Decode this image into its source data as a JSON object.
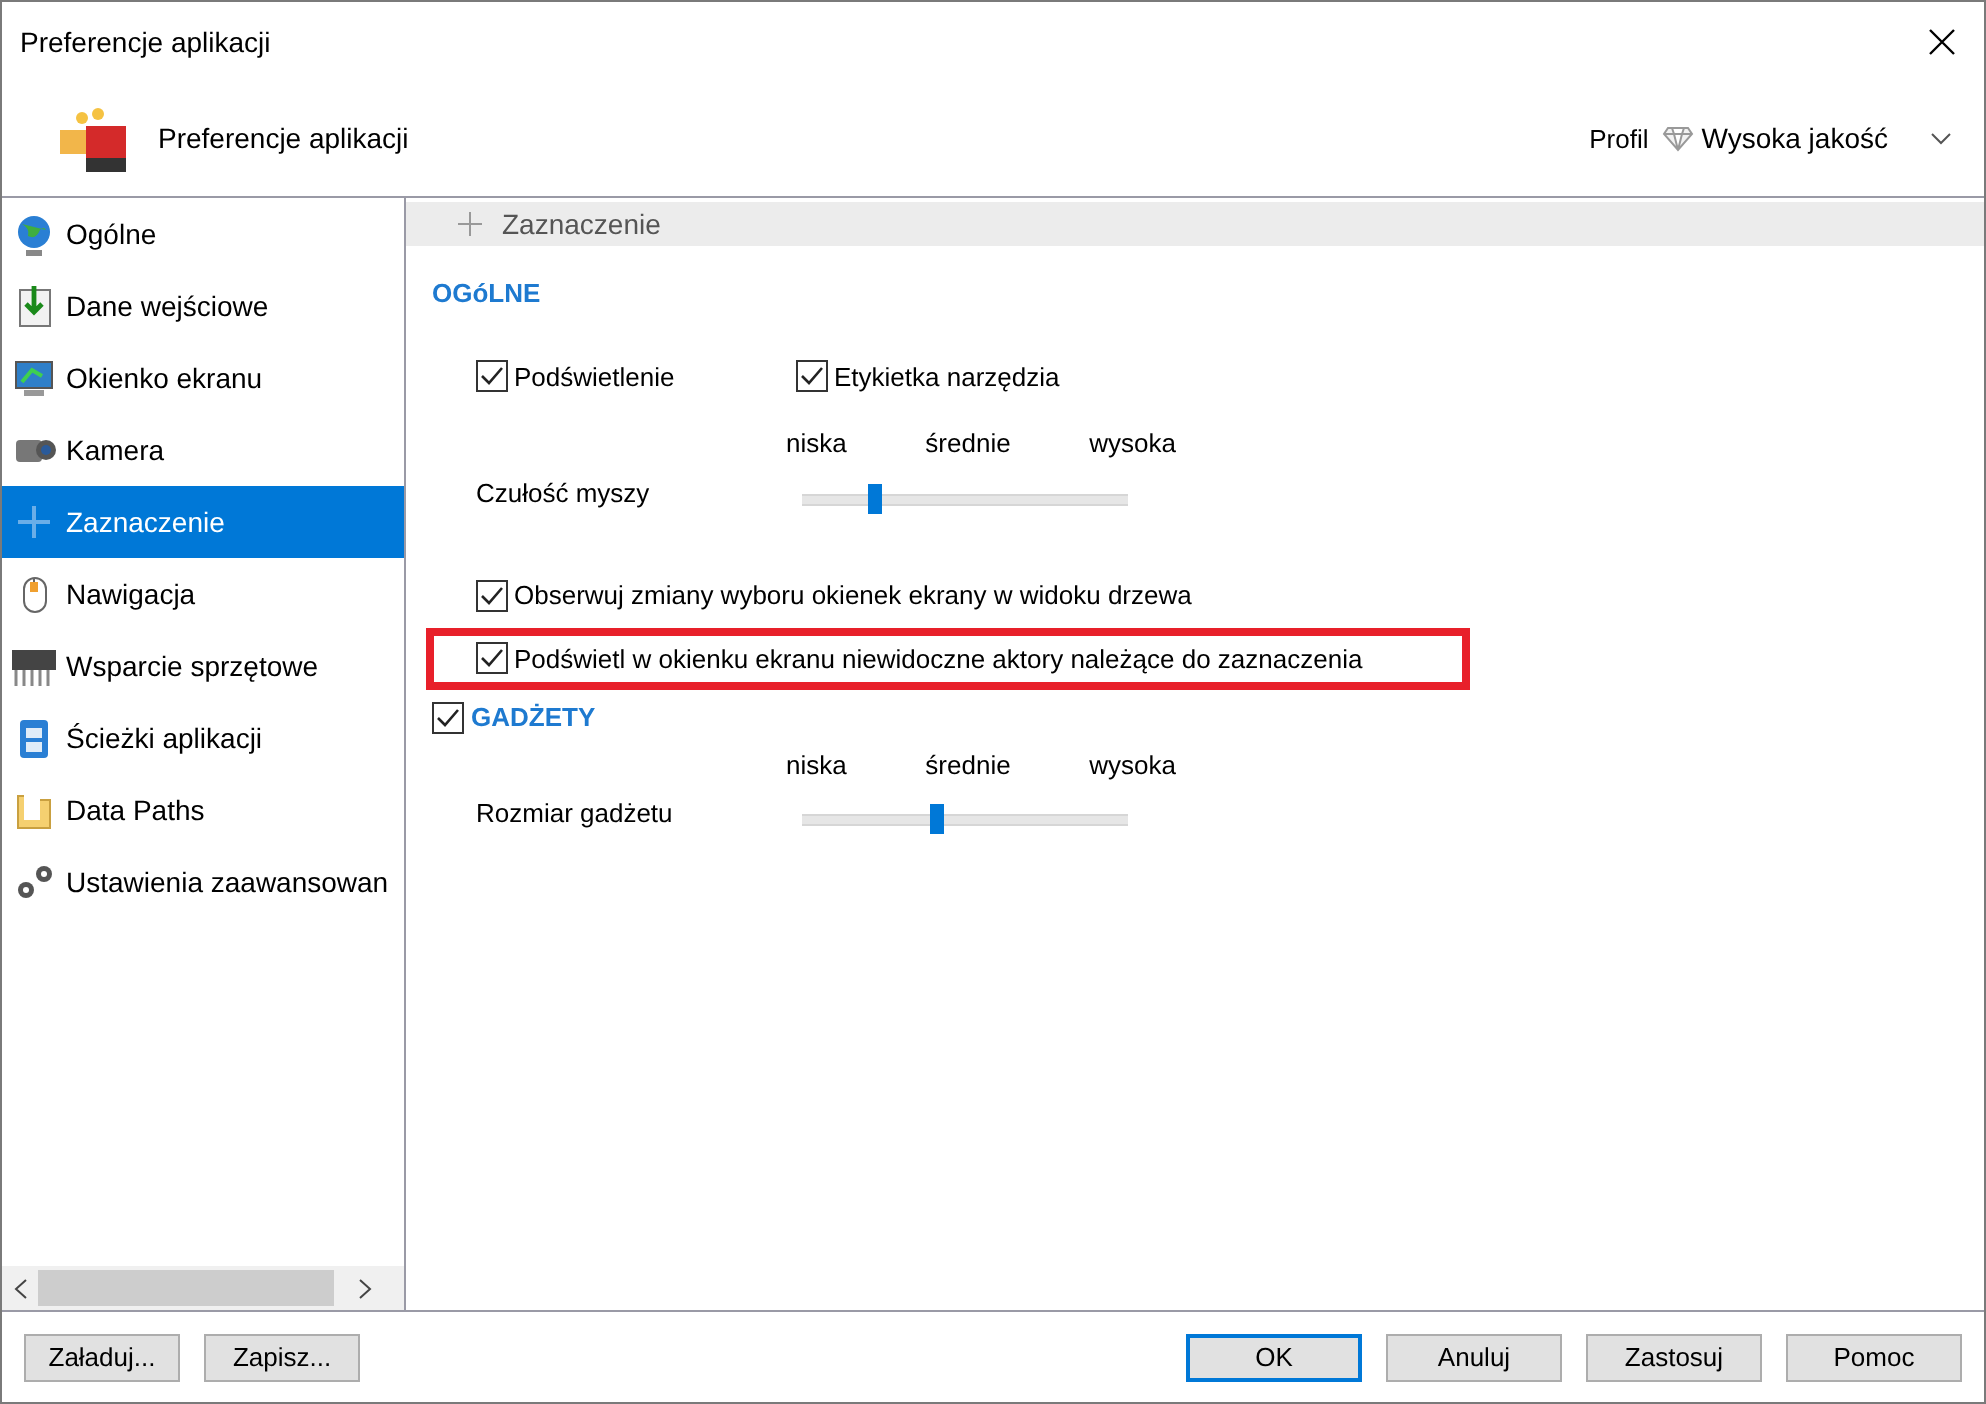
{
  "window": {
    "title": "Preferencje aplikacji"
  },
  "header": {
    "title": "Preferencje aplikacji",
    "profile_label": "Profil",
    "profile_value": "Wysoka jakość"
  },
  "sidebar": {
    "items": [
      {
        "label": "Ogólne",
        "selected": false
      },
      {
        "label": "Dane wejściowe",
        "selected": false
      },
      {
        "label": "Okienko ekranu",
        "selected": false
      },
      {
        "label": "Kamera",
        "selected": false
      },
      {
        "label": "Zaznaczenie",
        "selected": true
      },
      {
        "label": "Nawigacja",
        "selected": false
      },
      {
        "label": "Wsparcie sprzętowe",
        "selected": false
      },
      {
        "label": "Ścieżki aplikacji",
        "selected": false
      },
      {
        "label": "Data Paths",
        "selected": false
      },
      {
        "label": "Ustawienia zaawansowan",
        "selected": false
      }
    ]
  },
  "panel": {
    "title": "Zaznaczenie",
    "sections": [
      {
        "title": "OGóLNE",
        "rows": [
          {
            "kind": "checks",
            "items": [
              {
                "label": "Podświetlenie",
                "checked": true
              },
              {
                "label": "Etykietka narzędzia",
                "checked": true
              }
            ]
          },
          {
            "kind": "slider",
            "label": "Czułość myszy",
            "ticks": [
              "niska",
              "średnie",
              "wysoka"
            ],
            "level": 0.21
          },
          {
            "kind": "check",
            "label": "Obserwuj zmiany wyboru okienek ekrany w widoku drzewa",
            "checked": true
          },
          {
            "kind": "check",
            "label": "Podświetl w okienku ekranu niewidoczne aktory należące do zaznaczenia",
            "checked": true,
            "highlighted": true
          }
        ]
      },
      {
        "title": "GADŻETY",
        "checked": true,
        "rows": [
          {
            "kind": "slider",
            "label": "Rozmiar gadżetu",
            "ticks": [
              "niska",
              "średnie",
              "wysoka"
            ],
            "level": 0.4
          }
        ]
      }
    ]
  },
  "footer": {
    "left_buttons": [
      {
        "label": "Załaduj..."
      },
      {
        "label": "Zapisz..."
      }
    ],
    "right_buttons": [
      {
        "label": "OK",
        "default": true
      },
      {
        "label": "Anuluj",
        "default": false
      },
      {
        "label": "Zastosuj",
        "default": false
      },
      {
        "label": "Pomoc",
        "default": false
      }
    ]
  }
}
